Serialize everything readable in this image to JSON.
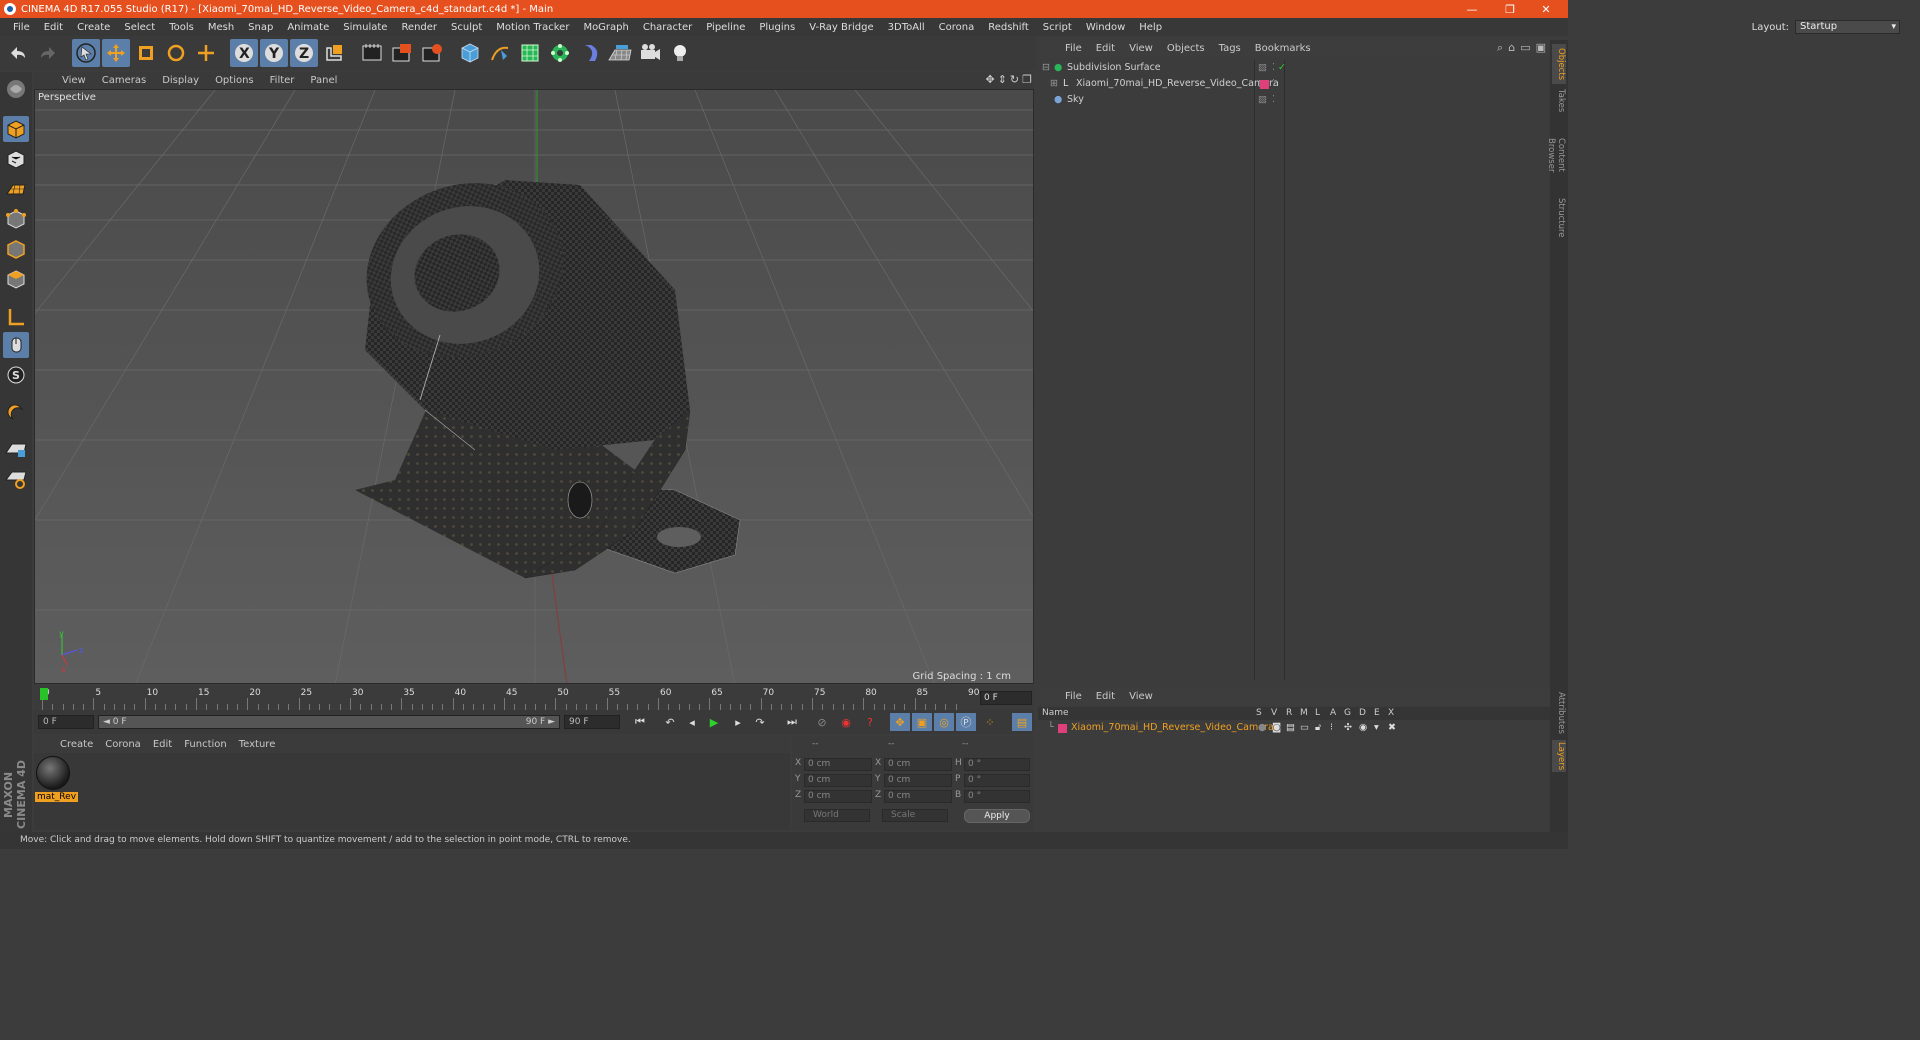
{
  "window": {
    "title": "CINEMA 4D R17.055 Studio (R17) - [Xiaomi_70mai_HD_Reverse_Video_Camera_c4d_standart.c4d *] - Main"
  },
  "menu": [
    "File",
    "Edit",
    "Create",
    "Select",
    "Tools",
    "Mesh",
    "Snap",
    "Animate",
    "Simulate",
    "Render",
    "Sculpt",
    "Motion Tracker",
    "MoGraph",
    "Character",
    "Pipeline",
    "Plugins",
    "V-Ray Bridge",
    "3DToAll",
    "Corona",
    "Redshift",
    "Script",
    "Window",
    "Help"
  ],
  "layout": {
    "label": "Layout:",
    "value": "Startup"
  },
  "toolbar": {
    "icons": [
      "undo-icon",
      "redo-icon",
      "select-arrow-icon",
      "move-icon",
      "scale-icon",
      "rotate-icon",
      "transform-icon",
      "x-axis-icon",
      "y-axis-icon",
      "z-axis-icon",
      "coordinate-system-icon",
      "render-view-icon",
      "render-picture-viewer-icon",
      "render-settings-icon",
      "cube-primitive-icon",
      "pen-spline-icon",
      "subdivision-icon",
      "array-icon",
      "deformer-icon",
      "floor-icon",
      "camera-icon",
      "light-icon"
    ]
  },
  "viewport": {
    "menu": [
      "View",
      "Cameras",
      "Display",
      "Options",
      "Filter",
      "Panel"
    ],
    "label": "Perspective",
    "grid_spacing": "Grid Spacing : 1 cm"
  },
  "timeline": {
    "ticks": [
      "0",
      "5",
      "10",
      "15",
      "20",
      "25",
      "30",
      "35",
      "40",
      "45",
      "50",
      "55",
      "60",
      "65",
      "70",
      "75",
      "80",
      "85",
      "90"
    ],
    "current_frame": "0 F",
    "start_field": "0 F",
    "range_start": "◄ 0 F",
    "range_end": "90 F ►",
    "end_field": "90 F"
  },
  "materials": {
    "menu": [
      "Create",
      "Corona",
      "Edit",
      "Function",
      "Texture"
    ],
    "items": [
      {
        "name": "mat_Rev"
      }
    ]
  },
  "coordinates": {
    "headers": [
      "--",
      "--",
      "--"
    ],
    "rows": [
      {
        "a": "X",
        "av": "0 cm",
        "b": "X",
        "bv": "0 cm",
        "c": "H",
        "cv": "0 °"
      },
      {
        "a": "Y",
        "av": "0 cm",
        "b": "Y",
        "bv": "0 cm",
        "c": "P",
        "cv": "0 °"
      },
      {
        "a": "Z",
        "av": "0 cm",
        "b": "Z",
        "bv": "0 cm",
        "c": "B",
        "cv": "0 °"
      }
    ],
    "mode": "World",
    "type": "Scale",
    "apply": "Apply"
  },
  "objects": {
    "menu": [
      "File",
      "Edit",
      "View",
      "Objects",
      "Tags",
      "Bookmarks"
    ],
    "items": [
      {
        "name": "Subdivision Surface"
      },
      {
        "name": "Xiaomi_70mai_HD_Reverse_Video_Camera"
      },
      {
        "name": "Sky"
      }
    ]
  },
  "layers": {
    "menu": [
      "File",
      "Edit",
      "View"
    ],
    "columns": [
      "Name",
      "S",
      "V",
      "R",
      "M",
      "L",
      "A",
      "G",
      "D",
      "E",
      "X"
    ],
    "items": [
      {
        "name": "Xiaomi_70mai_HD_Reverse_Video_Camera",
        "color": "#e0407a"
      }
    ]
  },
  "right_tabs": [
    "Objects",
    "Takes",
    "Content Browser",
    "Structure"
  ],
  "right_tabs_bottom": [
    "Attributes",
    "Layers"
  ],
  "status": "Move: Click and drag to move elements. Hold down SHIFT to quantize movement / add to the selection in point mode, CTRL to remove.",
  "brand": "MAXON CINEMA 4D",
  "colors": {
    "accent": "#e5501e",
    "active": "#5b7fa8",
    "material_label": "#f0a020",
    "layer_text": "#f0a020"
  }
}
